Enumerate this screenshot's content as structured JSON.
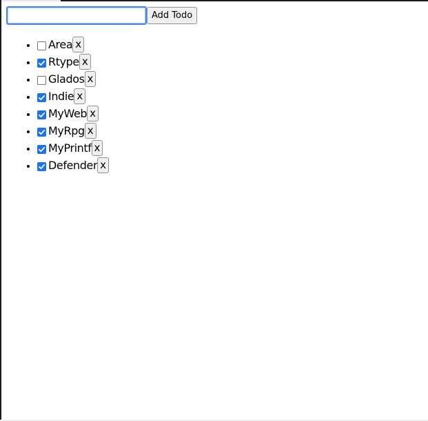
{
  "form": {
    "input_value": "",
    "input_placeholder": "",
    "add_button_label": "Add Todo"
  },
  "todos": [
    {
      "label": "Area",
      "completed": false,
      "remove_label": "x"
    },
    {
      "label": "Rtype",
      "completed": true,
      "remove_label": "x"
    },
    {
      "label": "Glados",
      "completed": false,
      "remove_label": "x"
    },
    {
      "label": "Indie",
      "completed": true,
      "remove_label": "x"
    },
    {
      "label": "MyWeb",
      "completed": true,
      "remove_label": "x"
    },
    {
      "label": "MyRpg",
      "completed": true,
      "remove_label": "x"
    },
    {
      "label": "MyPrintf",
      "completed": true,
      "remove_label": "x"
    },
    {
      "label": "Defender",
      "completed": true,
      "remove_label": "x"
    }
  ],
  "colors": {
    "checkbox_checked": "#1e73e8",
    "input_focus_border": "#4a87e8"
  },
  "icons": {
    "check": "checkmark-icon"
  }
}
